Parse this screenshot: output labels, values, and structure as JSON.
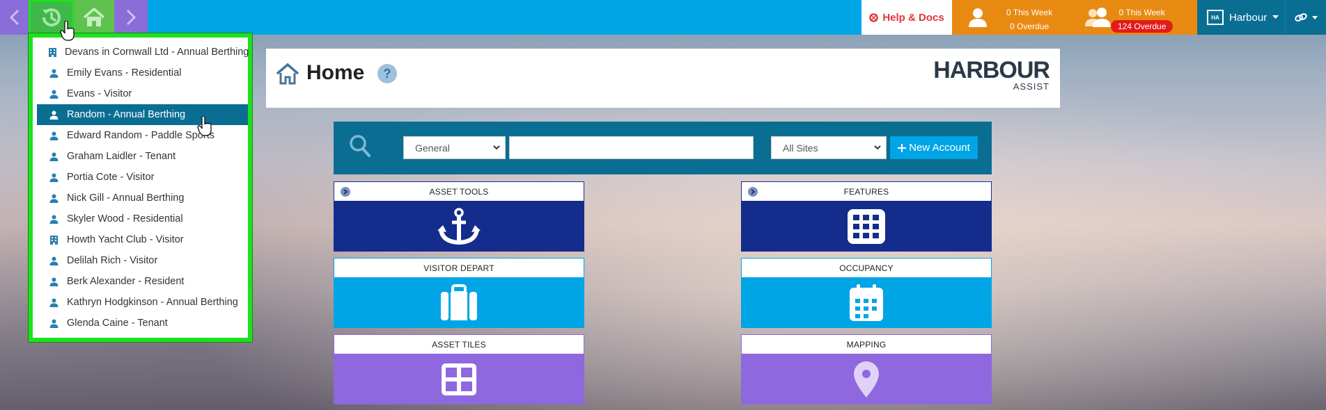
{
  "nav": {
    "back_icon": "chevron-left-icon",
    "history_icon": "history-clock-icon",
    "home_icon": "home-icon",
    "forward_icon": "chevron-right-icon"
  },
  "header": {
    "help_label": "Help & Docs",
    "stats": [
      {
        "this_week": "0 This Week",
        "overdue": "0 Overdue"
      },
      {
        "this_week": "0 This Week",
        "overdue": "124 Overdue"
      }
    ],
    "account_label": "Harbour",
    "logo_text": "HA"
  },
  "history_dropdown": {
    "items": [
      {
        "label": "Devans in Cornwall Ltd - Annual Berthing",
        "icon": "building-icon"
      },
      {
        "label": "Emily Evans - Residential",
        "icon": "person-icon"
      },
      {
        "label": "Evans - Visitor",
        "icon": "person-icon"
      },
      {
        "label": "Random - Annual Berthing",
        "icon": "person-icon",
        "active": true
      },
      {
        "label": "Edward Random - Paddle Sports",
        "icon": "person-icon"
      },
      {
        "label": "Graham Laidler - Tenant",
        "icon": "person-icon"
      },
      {
        "label": "Portia Cote - Visitor",
        "icon": "person-icon"
      },
      {
        "label": "Nick Gill - Annual Berthing",
        "icon": "person-icon"
      },
      {
        "label": "Skyler Wood - Residential",
        "icon": "person-icon"
      },
      {
        "label": "Howth Yacht Club - Visitor",
        "icon": "building-icon"
      },
      {
        "label": "Delilah Rich - Visitor",
        "icon": "person-icon"
      },
      {
        "label": "Berk Alexander - Resident",
        "icon": "person-icon"
      },
      {
        "label": "Kathryn Hodgkinson - Annual Berthing",
        "icon": "person-icon"
      },
      {
        "label": "Glenda Caine - Tenant",
        "icon": "person-icon"
      }
    ]
  },
  "page": {
    "title": "Home",
    "help_symbol": "?",
    "brand_main": "HARBOUR",
    "brand_sub": "ASSIST"
  },
  "search": {
    "type_selected": "General",
    "query_value": "",
    "sites_selected": "All Sites",
    "new_account_label": "New Account"
  },
  "tiles": [
    {
      "title": "ASSET TOOLS",
      "icon": "anchor-icon",
      "color": "#142c8c"
    },
    {
      "title": "FEATURES",
      "icon": "grid-icon",
      "color": "#142c8c"
    },
    {
      "title": "VISITOR DEPART",
      "icon": "suitcase-icon",
      "color": "#00a5e6"
    },
    {
      "title": "OCCUPANCY",
      "icon": "calendar-icon",
      "color": "#00a5e6"
    },
    {
      "title": "ASSET TILES",
      "icon": "tiles-icon",
      "color": "#8f67de"
    },
    {
      "title": "MAPPING",
      "icon": "map-pin-icon",
      "color": "#8f67de"
    }
  ],
  "colors": {
    "topbar": "#00a5e6",
    "navy": "#0a6e93",
    "orange": "#e88a12",
    "green_highlight": "#1ee01e",
    "purple": "#8a6dd9"
  }
}
